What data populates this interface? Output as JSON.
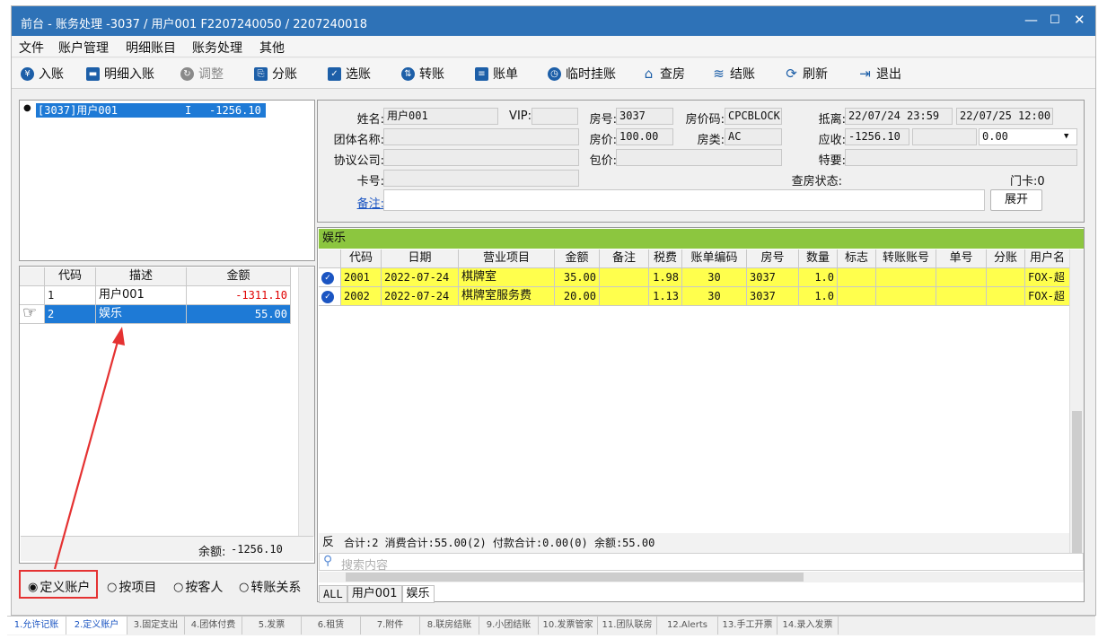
{
  "window": {
    "title": "前台 - 账务处理 -3037  /  用户001  F2207240050  /  2207240018"
  },
  "menu": [
    "文件",
    "账户管理",
    "明细账目",
    "账务处理",
    "其他"
  ],
  "toolbar": [
    {
      "label": "入账",
      "icon": "yen-icon"
    },
    {
      "label": "明细入账",
      "icon": "printer-icon"
    },
    {
      "label": "调整",
      "icon": "adjust-icon",
      "disabled": true
    },
    {
      "label": "分账",
      "icon": "split-icon"
    },
    {
      "label": "选账",
      "icon": "select-icon"
    },
    {
      "label": "转账",
      "icon": "transfer-icon"
    },
    {
      "label": "账单",
      "icon": "bill-icon"
    },
    {
      "label": "临时挂账",
      "icon": "clock-icon"
    },
    {
      "label": "查房",
      "icon": "house-icon"
    },
    {
      "label": "结账",
      "icon": "coins-icon"
    },
    {
      "label": "刷新",
      "icon": "refresh-icon"
    },
    {
      "label": "退出",
      "icon": "exit-icon"
    }
  ],
  "account_tree": {
    "item": "[3037]用户001",
    "flag": "I",
    "amount": "-1256.10"
  },
  "account_grid": {
    "headers": [
      "代码",
      "描述",
      "金额"
    ],
    "rows": [
      {
        "code": "1",
        "desc": "用户001",
        "amount": "-1311.10"
      },
      {
        "code": "2",
        "desc": "娱乐",
        "amount": "55.00"
      }
    ],
    "balance_label": "余额:",
    "balance": "-1256.10"
  },
  "radio": [
    "定义账户",
    "按项目",
    "按客人",
    "转账关系"
  ],
  "info": {
    "name_label": "姓名:",
    "name": "用户001",
    "vip_label": "VIP:",
    "vip": "",
    "room_label": "房号:",
    "room": "3037",
    "rate_code_label": "房价码:",
    "rate_code": "CPCBLOCK",
    "arr_dep_label": "抵离:",
    "arrive": "22/07/24 23:59",
    "depart": "22/07/25 12:00",
    "group_label": "团体名称:",
    "group": "",
    "rate_label": "房价:",
    "rate": "100.00",
    "room_type_label": "房类:",
    "room_type": "AC",
    "receivable_label": "应收:",
    "receivable": "-1256.10",
    "credit": "0.00",
    "company_label": "协议公司:",
    "company": "",
    "package_label": "包价:",
    "package": "",
    "special_label": "特要:",
    "special": "",
    "card_label": "卡号:",
    "card": "",
    "check_label": "查房状态:",
    "door_card_label": "门卡:",
    "door_card": "0",
    "note_label": "备注:",
    "expand_button": "展开"
  },
  "detail": {
    "section": "娱乐",
    "headers": [
      "代码",
      "日期",
      "营业项目",
      "金额",
      "备注",
      "税费",
      "账单编码",
      "房号",
      "数量",
      "标志",
      "转账账号",
      "单号",
      "分账",
      "用户名"
    ],
    "rows": [
      {
        "code": "2001",
        "date": "2022-07-24",
        "item": "棋牌室",
        "amount": "35.00",
        "note": "",
        "tax": "1.98",
        "bill": "30",
        "room": "3037",
        "qty": "1.0",
        "flag": "",
        "transfer": "",
        "no": "",
        "split": "",
        "user": "FOX-超"
      },
      {
        "code": "2002",
        "date": "2022-07-24",
        "item": "棋牌室服务费",
        "amount": "20.00",
        "note": "",
        "tax": "1.13",
        "bill": "30",
        "room": "3037",
        "qty": "1.0",
        "flag": "",
        "transfer": "",
        "no": "",
        "split": "",
        "user": "FOX-超"
      }
    ],
    "summary_rev": "反",
    "summary": "合计:2  消费合计:55.00(2)  付款合计:0.00(0)  余额:55.00",
    "search_placeholder": "搜索内容",
    "tabs": [
      "ALL",
      "用户001",
      "娱乐"
    ]
  },
  "bottom_tabs": [
    "1.允许记账",
    "2.定义账户",
    "3.固定支出",
    "4.团体付费",
    "5.发票",
    "6.租赁",
    "7.附件",
    "8.联房结账",
    "9.小团结账",
    "10.发票管家",
    "11.团队联房",
    "12.Alerts",
    "13.手工开票",
    "14.录入发票"
  ]
}
